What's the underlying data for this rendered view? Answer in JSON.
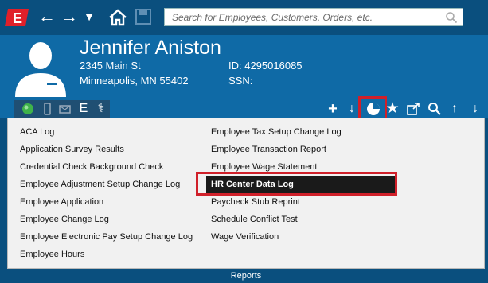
{
  "toolbar": {
    "search_placeholder": "Search for Employees, Customers, Orders, etc."
  },
  "employee": {
    "name": "Jennifer Aniston",
    "address_line1": "2345 Main St",
    "address_line2": "Minneapolis, MN 55402",
    "id_label": "ID: 4295016085",
    "ssn_label": "SSN:"
  },
  "reports_menu": {
    "left_column": [
      "ACA Log",
      "Application Survey Results",
      "Credential Check Background Check",
      "Employee Adjustment Setup Change Log",
      "Employee Application",
      "Employee Change Log",
      "Employee Electronic Pay Setup Change Log",
      "Employee Hours"
    ],
    "right_column": [
      "Employee Tax Setup Change Log",
      "Employee Transaction Report",
      "Employee Wage Statement",
      "HR Center Data Log",
      "Paycheck Stub Reprint",
      "Schedule Conflict Test",
      "Wage Verification"
    ],
    "selected": "HR Center Data Log",
    "footer_label": "Reports"
  },
  "colors": {
    "toolbar_bg": "#0a4f7e",
    "header_bg": "#0f6aa6",
    "highlight": "#d0202a",
    "selected_bg": "#1a1a1a"
  }
}
